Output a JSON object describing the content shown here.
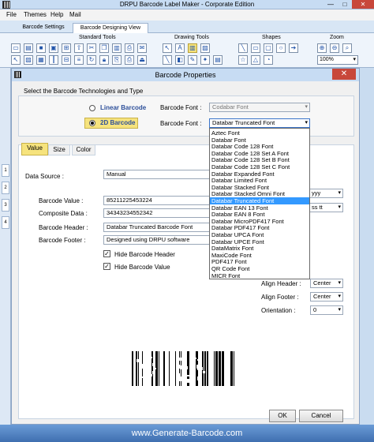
{
  "app": {
    "title": "DRPU Barcode Label Maker - Corporate Edition",
    "minimize": "—",
    "maximize": "□",
    "close": "✕"
  },
  "menu": [
    "File",
    "Themes",
    "Help",
    "Mail"
  ],
  "main_tabs": [
    "Barcode Settings",
    "Barcode Designing View"
  ],
  "ribbon": {
    "groups": [
      "Standard Tools",
      "Drawing Tools",
      "Shapes",
      "Zoom"
    ],
    "zoom_value": "100%"
  },
  "dialog": {
    "title": "Barcode Properties",
    "close": "✕",
    "tech_label": "Select the Barcode Technologies and Type",
    "linear_label": "Linear Barcode",
    "twod_label": "2D Barcode",
    "barcode_font_label": "Barcode Font :",
    "linear_font_value": "Codabar Font",
    "twod_font_value": "Databar Truncated Font",
    "tabs": [
      "Value",
      "Size",
      "Color"
    ],
    "data_source_label": "Data Source :",
    "data_source_value": "Manual",
    "barcode_value_label": "Barcode Value :",
    "barcode_value": "85211225453224",
    "composite_label": "Composite Data :",
    "composite_value": "34343234552342",
    "header_label": "Barcode Header :",
    "header_value": "Databar Truncated Barcode Font",
    "footer_label": "Barcode Footer :",
    "footer_value": "Designed using DRPU software",
    "hide_header_label": "Hide Barcode Header",
    "hide_value_label": "Hide Barcode Value",
    "date_format_partial": "yyy",
    "time_format_partial": "ss tt",
    "align_header_label": "Align Header :",
    "align_header_value": "Center",
    "align_footer_label": "Align Footer :",
    "align_footer_value": "Center",
    "orientation_label": "Orientation :",
    "orientation_value": "0",
    "ok_label": "OK",
    "cancel_label": "Cancel"
  },
  "font_list": [
    "Aztec Font",
    "Databar Font",
    "Databar Code 128 Font",
    "Databar Code 128 Set A Font",
    "Databar Code 128 Set B Font",
    "Databar Code 128 Set C Font",
    "Databar Expanded Font",
    "Databar Limited Font",
    "Databar Stacked Font",
    "Databar Stacked Omni Font",
    "Databar Truncated Font",
    "Databar EAN 13 Font",
    "Databar EAN 8 Font",
    "Databar MicroPDF417 Font",
    "Databar PDF417 Font",
    "Databar UPCA Font",
    "Databar UPCE Font",
    "DataMatrix Font",
    "MaxiCode Font",
    "PDF417 Font",
    "QR Code Font",
    "MICR Font"
  ],
  "font_list_selected_index": 10,
  "side_tabs": [
    "1",
    "2",
    "3",
    "4"
  ],
  "footer_banner": "www.Generate-Barcode.com"
}
